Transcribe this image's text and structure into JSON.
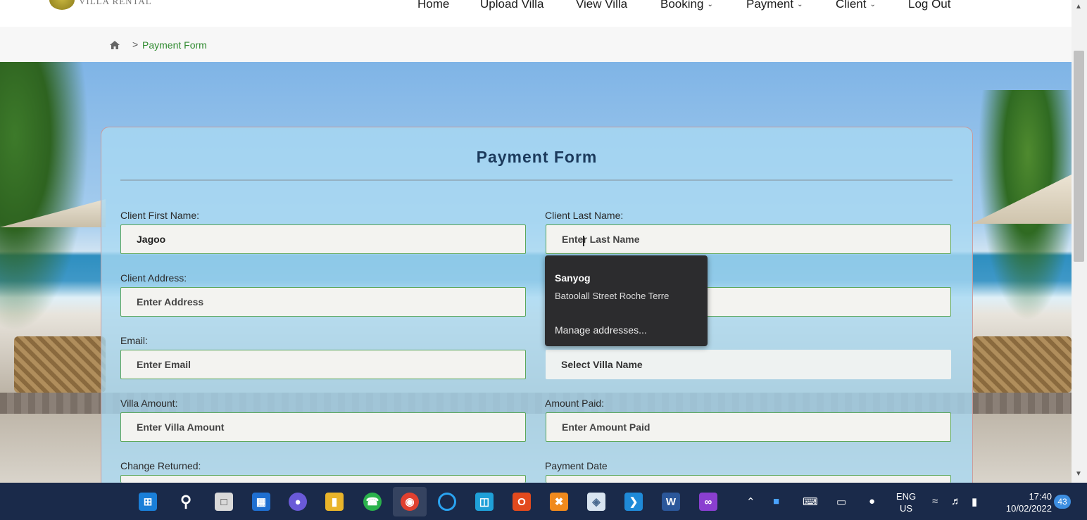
{
  "logo": {
    "text": "VILLA RENTAL"
  },
  "nav": {
    "items": [
      {
        "label": "Home",
        "dropdown": false
      },
      {
        "label": "Upload Villa",
        "dropdown": false
      },
      {
        "label": "View Villa",
        "dropdown": false
      },
      {
        "label": "Booking",
        "dropdown": true
      },
      {
        "label": "Payment",
        "dropdown": true
      },
      {
        "label": "Client",
        "dropdown": true
      },
      {
        "label": "Log Out",
        "dropdown": false
      }
    ]
  },
  "breadcrumb": {
    "separator": ">",
    "current": "Payment Form"
  },
  "form": {
    "title": "Payment Form",
    "fields": {
      "first_name": {
        "label": "Client First Name:",
        "value": "Jagoo"
      },
      "last_name": {
        "label": "Client Last Name:",
        "placeholder": "Enter Last Name"
      },
      "address": {
        "label": "Client Address:",
        "placeholder": "Enter Address"
      },
      "email": {
        "label": "Email:",
        "placeholder": "Enter Email"
      },
      "villa_name": {
        "value": "Select Villa Name"
      },
      "villa_amount": {
        "label": "Villa Amount:",
        "placeholder": "Enter Villa Amount"
      },
      "amount_paid": {
        "label": "Amount Paid:",
        "placeholder": "Enter Amount Paid"
      },
      "change_returned": {
        "label": "Change Returned:"
      },
      "payment_date": {
        "label": "Payment Date"
      }
    }
  },
  "autofill": {
    "name": "Sanyog",
    "address": "Batoolall Street Roche Terre",
    "manage": "Manage addresses..."
  },
  "taskbar": {
    "language": "ENG",
    "region": "US",
    "time": "17:40",
    "date": "10/02/2022",
    "notifications": "43"
  },
  "colors": {
    "accent_green": "#2f8a2f",
    "panel_title": "#1c3a5c",
    "taskbar": "#1a2a4a"
  }
}
